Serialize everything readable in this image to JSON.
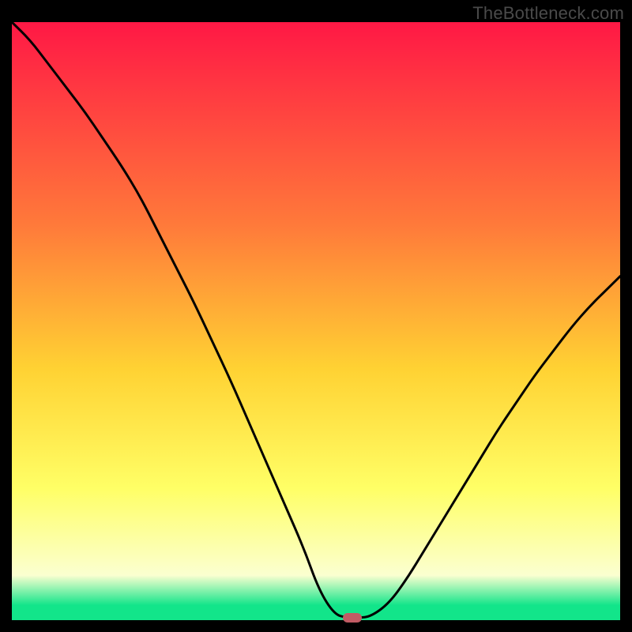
{
  "watermark": "TheBottleneck.com",
  "colors": {
    "top": "#ff1845",
    "mid_upper": "#ff7a3a",
    "mid": "#ffd233",
    "mid_lower": "#ffff66",
    "pale": "#fbffd0",
    "green": "#12e58a",
    "curve": "#000000",
    "background": "#000000",
    "marker": "#c15b64"
  },
  "chart_data": {
    "type": "line",
    "title": "",
    "xlabel": "",
    "ylabel": "",
    "xlim": [
      0,
      100
    ],
    "ylim": [
      0,
      100
    ],
    "x": [
      0,
      3,
      6,
      9,
      12,
      15,
      18,
      21,
      24,
      27,
      30,
      33,
      36,
      39,
      42,
      45,
      48,
      50.5,
      53,
      55,
      57,
      59,
      62,
      65,
      68,
      71,
      74,
      77,
      80,
      83,
      86,
      89,
      92,
      95,
      98,
      100
    ],
    "values": [
      100,
      97,
      93,
      89,
      85,
      80.5,
      76,
      71,
      65,
      59,
      53,
      46.5,
      40,
      33,
      26,
      19,
      12,
      5,
      1,
      0.4,
      0.4,
      0.6,
      2.8,
      7,
      12,
      17,
      22,
      27,
      32,
      36.5,
      41,
      45,
      49,
      52.5,
      55.5,
      57.5
    ],
    "marker": {
      "x": 56,
      "y": 0.4
    },
    "gradient_stops": [
      {
        "offset": 0.0,
        "key": "top"
      },
      {
        "offset": 0.34,
        "key": "mid_upper"
      },
      {
        "offset": 0.58,
        "key": "mid"
      },
      {
        "offset": 0.78,
        "key": "mid_lower"
      },
      {
        "offset": 0.925,
        "key": "pale"
      },
      {
        "offset": 0.975,
        "key": "green"
      },
      {
        "offset": 1.0,
        "key": "green"
      }
    ]
  }
}
